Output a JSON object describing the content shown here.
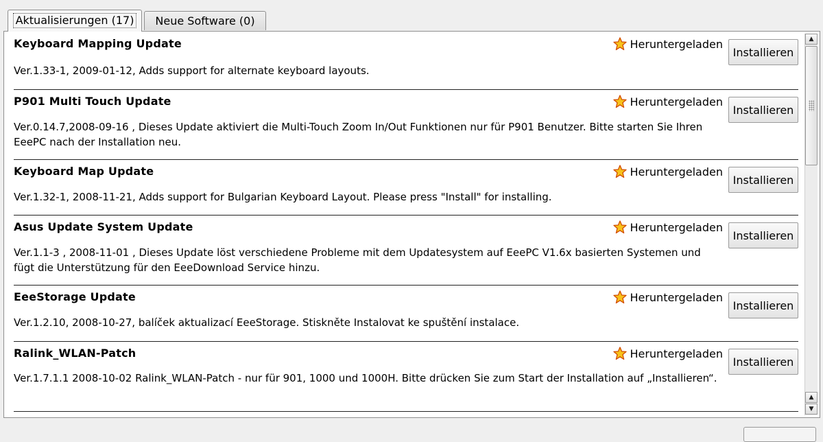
{
  "tabs": [
    {
      "label": "Aktualisierungen (17)",
      "active": true
    },
    {
      "label": "Neue Software (0)",
      "active": false
    }
  ],
  "status_icon": "star-icon",
  "colors": {
    "star_fill": "#f7c21b",
    "star_outline": "#d14a00"
  },
  "updates": [
    {
      "title": "Keyboard Mapping Update",
      "desc": "Ver.1.33-1, 2009-01-12, Adds support for alternate keyboard layouts.",
      "status": "Heruntergeladen",
      "button": "Installieren"
    },
    {
      "title": "P901 Multi Touch Update",
      "desc": "Ver.0.14.7,2008-09-16 , Dieses Update aktiviert die Multi-Touch Zoom In/Out Funktionen nur für P901 Benutzer. Bitte starten Sie Ihren EeePC nach der Installation neu.",
      "status": "Heruntergeladen",
      "button": "Installieren"
    },
    {
      "title": "Keyboard Map Update",
      "desc": "Ver.1.32-1, 2008-11-21, Adds support for Bulgarian Keyboard Layout. Please press \"Install\" for installing.",
      "status": "Heruntergeladen",
      "button": "Installieren"
    },
    {
      "title": "Asus Update System Update",
      "desc": "Ver.1.1-3 , 2008-11-01 , Dieses Update löst verschiedene Probleme mit dem Updatesystem auf EeePC V1.6x basierten Systemen und fügt die Unterstützung für den EeeDownload Service hinzu.",
      "status": "Heruntergeladen",
      "button": "Installieren"
    },
    {
      "title": "EeeStorage Update",
      "desc": "Ver.1.2.10, 2008-10-27, balíček aktualizací EeeStorage. Stiskněte Instalovat ke spuštění instalace.",
      "status": "Heruntergeladen",
      "button": "Installieren"
    },
    {
      "title": "Ralink_WLAN-Patch",
      "desc": "Ver.1.7.1.1 2008-10-02 Ralink_WLAN-Patch - nur für 901, 1000 und 1000H. Bitte drücken Sie zum Start der Installation auf „Installieren“.",
      "status": "Heruntergeladen",
      "button": "Installieren"
    }
  ]
}
